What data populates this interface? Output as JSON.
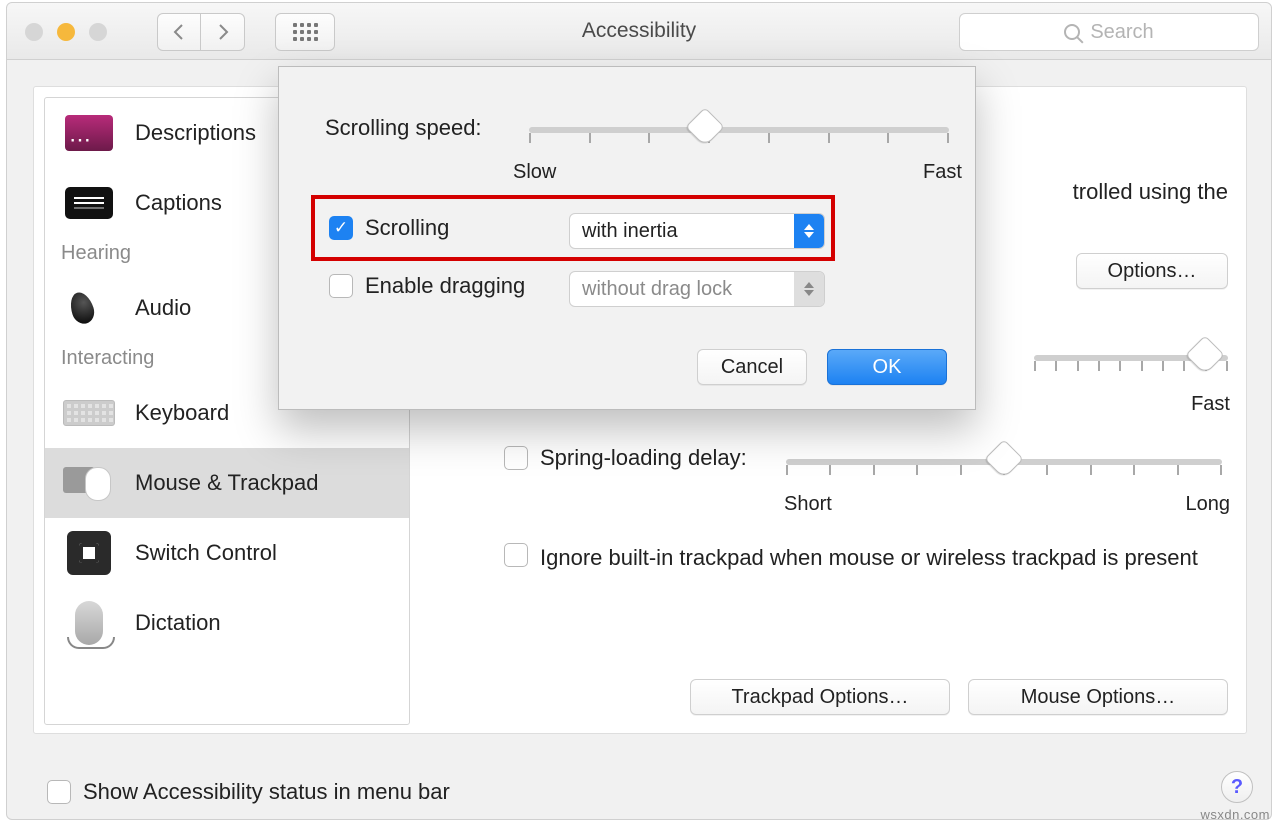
{
  "window": {
    "title": "Accessibility",
    "search_placeholder": "Search"
  },
  "sidebar": {
    "items": [
      {
        "label": "Descriptions"
      },
      {
        "label": "Captions"
      }
    ],
    "group1": "Hearing",
    "items2": [
      {
        "label": "Audio"
      }
    ],
    "group2": "Interacting",
    "items3": [
      {
        "label": "Keyboard"
      },
      {
        "label": "Mouse & Trackpad",
        "selected": true
      },
      {
        "label": "Switch Control"
      },
      {
        "label": "Dictation"
      }
    ]
  },
  "main": {
    "partial_text_right": "trolled using the",
    "options_button": "Options…",
    "slider2_fast": "Fast",
    "spring_label": "Spring-loading delay:",
    "spring_left": "Short",
    "spring_right": "Long",
    "ignore_label": "Ignore built-in trackpad when mouse or wireless trackpad is present",
    "trackpad_options": "Trackpad Options…",
    "mouse_options": "Mouse Options…"
  },
  "sheet": {
    "scrolling_speed_label": "Scrolling speed:",
    "slow": "Slow",
    "fast": "Fast",
    "scrolling_checkbox": "Scrolling",
    "scrolling_value": "with inertia",
    "dragging_checkbox": "Enable dragging",
    "dragging_value": "without drag lock",
    "cancel": "Cancel",
    "ok": "OK"
  },
  "footer": {
    "show_status": "Show Accessibility status in menu bar"
  },
  "watermark": "wsxdn.com"
}
